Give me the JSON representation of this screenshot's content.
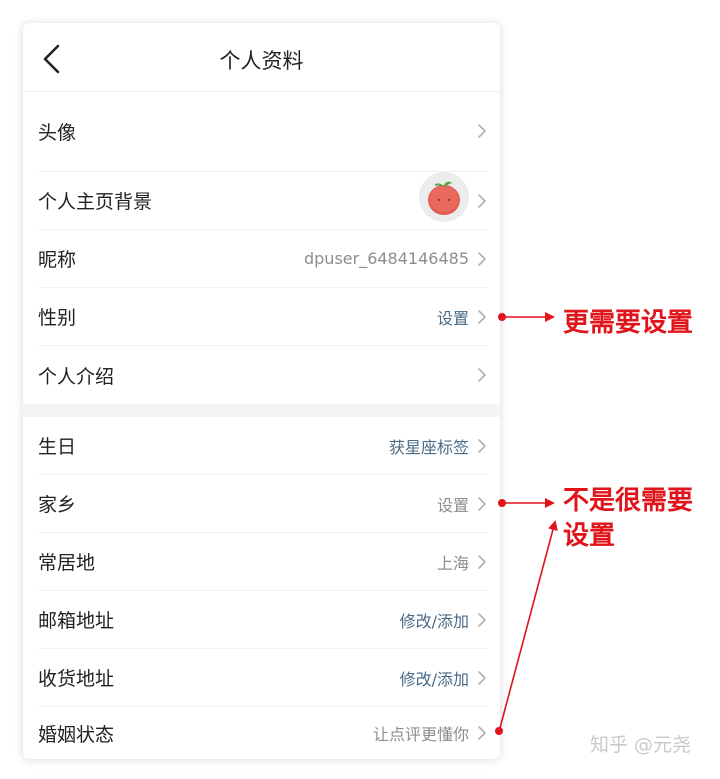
{
  "header": {
    "title": "个人资料"
  },
  "rows_top": [
    {
      "label": "头像"
    },
    {
      "label": "个人主页背景",
      "value": ""
    },
    {
      "label": "昵称",
      "value": "dpuser_6484146485"
    },
    {
      "label": "性别",
      "value": "设置"
    },
    {
      "label": "个人介绍",
      "value": ""
    }
  ],
  "rows_bottom": [
    {
      "label": "生日",
      "value": "获星座标签"
    },
    {
      "label": "家乡",
      "value": "设置"
    },
    {
      "label": "常居地",
      "value": "上海"
    },
    {
      "label": "邮箱地址",
      "value": "修改/添加"
    },
    {
      "label": "收货地址",
      "value": "修改/添加"
    },
    {
      "label": "婚姻状态",
      "value": "让点评更懂你"
    }
  ],
  "annotations": {
    "more_needed": "更需要设置",
    "less_needed_line1": "不是很需要",
    "less_needed_line2": "设置"
  },
  "watermark": "知乎 @元尧",
  "colors": {
    "accent_value": "#4a6a86",
    "annotation_red": "#e0141b"
  },
  "icons": {
    "back": "chevron-left-icon",
    "row_arrow": "chevron-right-icon",
    "avatar": "tomato-avatar"
  }
}
